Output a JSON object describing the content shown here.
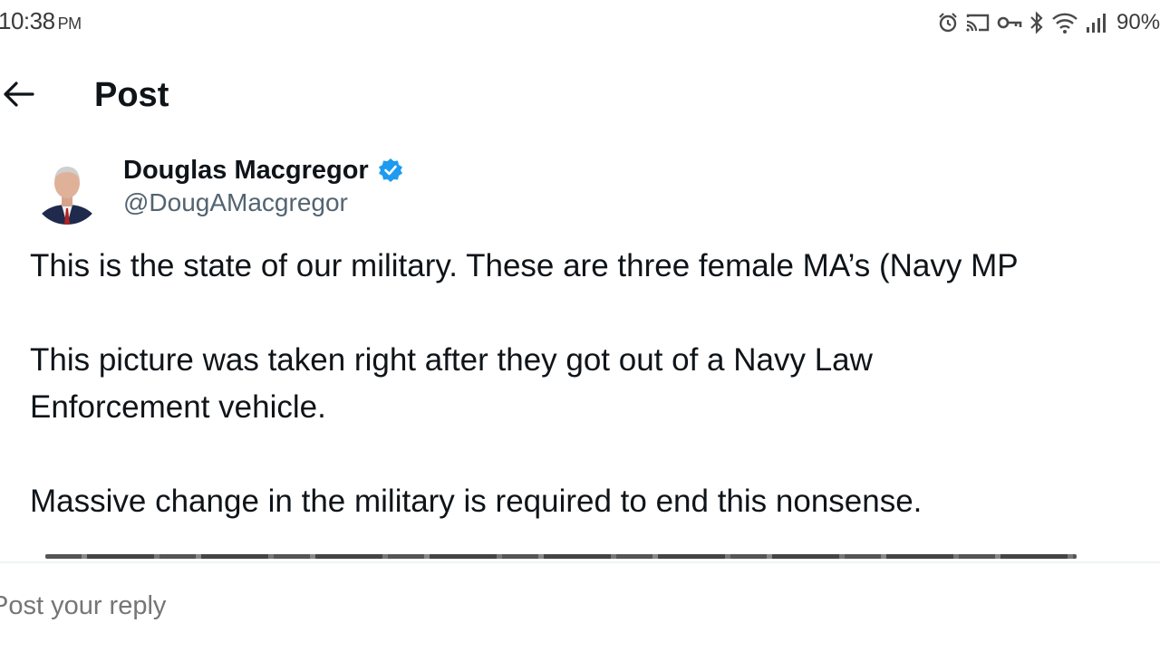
{
  "status_bar": {
    "time": "10:38",
    "ampm": "PM",
    "battery": "90%",
    "icons": [
      "alarm-icon",
      "cast-icon",
      "vpn-key-icon",
      "bluetooth-icon",
      "wifi-icon",
      "signal-icon"
    ]
  },
  "header": {
    "title": "Post",
    "back_icon": "arrow-left-icon"
  },
  "author": {
    "name": "Douglas Macgregor",
    "handle": "@DougAMacgregor",
    "verified": true,
    "verified_color": "#1d9bf0"
  },
  "post": {
    "line1": "This is the state of our military. These are three female MA’s (Navy MP",
    "line2": "This picture was taken right after they got out of a Navy Law",
    "line3": "Enforcement vehicle.",
    "line4": "Massive change in the military is required to end this nonsense."
  },
  "reply": {
    "placeholder": "Post your reply"
  }
}
